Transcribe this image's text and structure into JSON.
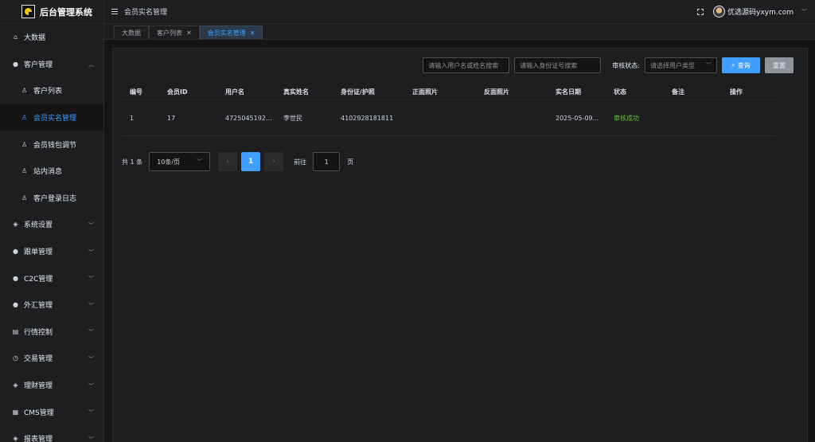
{
  "app": {
    "title": "后台管理系统"
  },
  "sidebar": {
    "items": [
      {
        "label": "大数据",
        "icon": "home-icon",
        "expandable": false
      },
      {
        "label": "客户管理",
        "icon": "person-circle-icon",
        "expandable": true,
        "expanded": true,
        "children": [
          {
            "label": "客户列表",
            "icon": "thumb-icon",
            "active": false
          },
          {
            "label": "会员实名管理",
            "icon": "thumb-icon",
            "active": true
          },
          {
            "label": "会员钱包调节",
            "icon": "thumb-icon",
            "active": false
          },
          {
            "label": "站内消息",
            "icon": "thumb-icon",
            "active": false
          },
          {
            "label": "客户登录日志",
            "icon": "thumb-icon",
            "active": false
          }
        ]
      },
      {
        "label": "系统设置",
        "icon": "shield-icon",
        "expandable": true
      },
      {
        "label": "跟单管理",
        "icon": "person-circle-icon",
        "expandable": true
      },
      {
        "label": "C2C管理",
        "icon": "person-circle-icon",
        "expandable": true
      },
      {
        "label": "外汇管理",
        "icon": "person-circle-icon",
        "expandable": true
      },
      {
        "label": "行情控制",
        "icon": "chart-icon",
        "expandable": true
      },
      {
        "label": "交易管理",
        "icon": "clock-icon",
        "expandable": true
      },
      {
        "label": "理财管理",
        "icon": "shield-icon",
        "expandable": true
      },
      {
        "label": "CMS管理",
        "icon": "calendar-icon",
        "expandable": true
      },
      {
        "label": "报表管理",
        "icon": "shield-icon",
        "expandable": true
      }
    ]
  },
  "header": {
    "breadcrumb": "会员实名管理",
    "user_name": "优选源码yxym.com"
  },
  "tags": [
    {
      "label": "大数据",
      "closable": false,
      "active": false
    },
    {
      "label": "客户列表",
      "closable": true,
      "active": false
    },
    {
      "label": "会员实名管理",
      "closable": true,
      "active": true
    }
  ],
  "filters": {
    "name_placeholder": "请输入用户名或姓名搜索",
    "idcard_placeholder": "请输入身份证号搜索",
    "status_label": "审核状态:",
    "status_placeholder": "请选择用户类型",
    "search_label": "查询",
    "reset_label": "重置"
  },
  "table": {
    "columns": [
      "编号",
      "会员ID",
      "用户名",
      "真实姓名",
      "身份证/护照",
      "正面照片",
      "反面照片",
      "实名日期",
      "状态",
      "备注",
      "操作"
    ],
    "rows": [
      [
        "1",
        "17",
        "4725045192...",
        "李世民",
        "4102928181811",
        "",
        "",
        "2025-05-09...",
        "审核成功",
        "",
        ""
      ]
    ]
  },
  "pagination": {
    "total_text": "共 1 条",
    "page_size": "10条/页",
    "prev": "‹",
    "current": "1",
    "next": "›",
    "goto_label": "前往",
    "goto_value": "1",
    "page_unit": "页"
  },
  "colors": {
    "accent": "#409eff",
    "success": "#67c23a",
    "bg": "#141414",
    "panel": "#1d1e1f"
  }
}
